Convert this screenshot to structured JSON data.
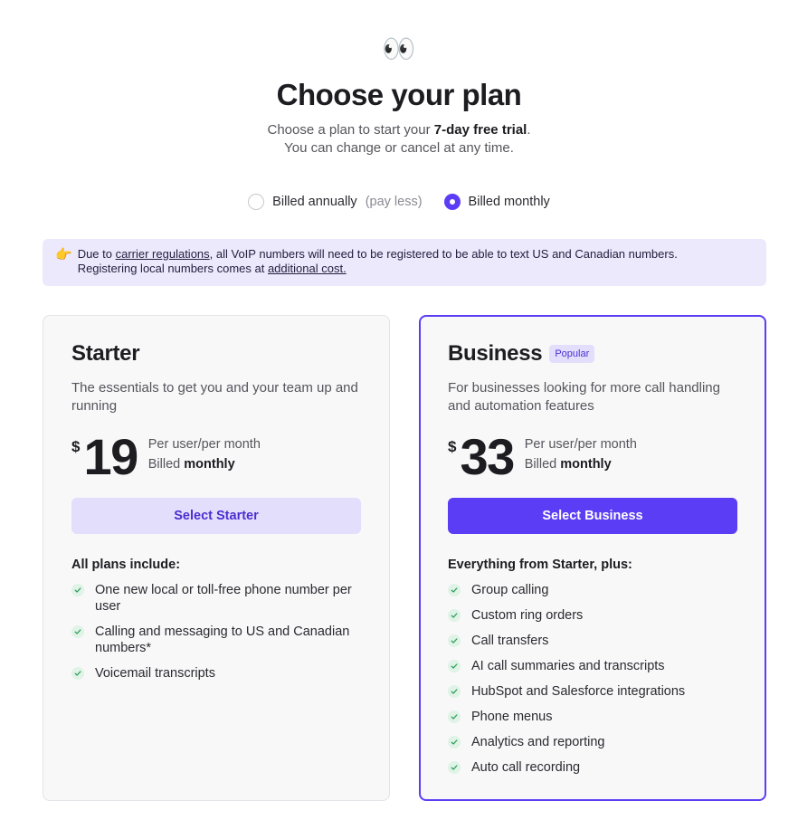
{
  "header": {
    "emoji": "👀",
    "title": "Choose your plan",
    "subtitle_prefix": "Choose a plan to start your ",
    "subtitle_bold": "7-day free trial",
    "subtitle_suffix": ".",
    "subtitle_line2": "You can change or cancel at any time."
  },
  "billing": {
    "annual_label": "Billed annually",
    "annual_hint": "(pay less)",
    "monthly_label": "Billed monthly",
    "selected": "monthly"
  },
  "notice": {
    "icon": "👉",
    "text1": "Due to ",
    "link1": "carrier regulations",
    "text2": ", all VoIP numbers will need to be registered to be able to text US and Canadian numbers.",
    "text3": "Registering local numbers comes at ",
    "link2": "additional cost."
  },
  "plans": {
    "starter": {
      "name": "Starter",
      "description": "The essentials to get you and your team up and running",
      "currency": "$",
      "price": "19",
      "per": "Per user/per month",
      "billed_prefix": "Billed ",
      "billed_bold": "monthly",
      "button": "Select Starter",
      "features_heading": "All plans include:",
      "features": [
        "One new local or toll-free phone number per user",
        "Calling and messaging to US and Canadian numbers*",
        "Voicemail transcripts"
      ]
    },
    "business": {
      "name": "Business",
      "badge": "Popular",
      "description": "For businesses looking for more call handling and automation features",
      "currency": "$",
      "price": "33",
      "per": "Per user/per month",
      "billed_prefix": "Billed ",
      "billed_bold": "monthly",
      "button": "Select Business",
      "features_heading": "Everything from Starter, plus:",
      "features": [
        "Group calling",
        "Custom ring orders",
        "Call transfers",
        "AI call summaries and transcripts",
        "HubSpot and Salesforce integrations",
        "Phone menus",
        "Analytics and reporting",
        "Auto call recording"
      ]
    }
  },
  "colors": {
    "accent": "#5b3df5",
    "accent_light": "#e4defd",
    "notice_bg": "#ece9fd",
    "check_bg": "#dff3e6",
    "check_fg": "#2e9b5a"
  }
}
